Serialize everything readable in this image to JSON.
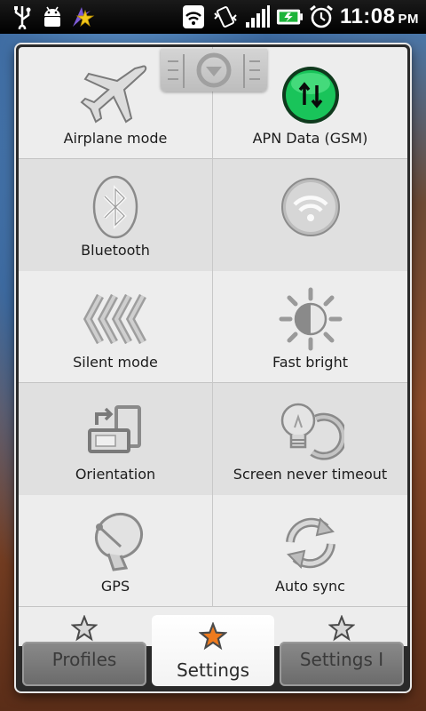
{
  "status_bar": {
    "left_icons": [
      "usb-icon",
      "android-debug-icon",
      "app-notification-icon"
    ],
    "right_icons": [
      "wifi-icon",
      "vibrate-icon",
      "signal-icon",
      "battery-icon",
      "alarm-icon"
    ],
    "time": "11:08",
    "ampm": "PM"
  },
  "grid": {
    "items": [
      {
        "label": "Airplane mode",
        "icon": "airplane-icon"
      },
      {
        "label": "APN Data (GSM)",
        "icon": "apn-data-icon",
        "state": "on"
      },
      {
        "label": "Bluetooth",
        "icon": "bluetooth-icon"
      },
      {
        "label": "",
        "icon": "wifi-toggle-icon"
      },
      {
        "label": "Silent mode",
        "icon": "silent-mode-icon"
      },
      {
        "label": "Fast bright",
        "icon": "brightness-icon"
      },
      {
        "label": "Orientation",
        "icon": "orientation-icon"
      },
      {
        "label": "Screen never timeout",
        "icon": "screen-timeout-icon"
      },
      {
        "label": "GPS",
        "icon": "gps-icon"
      },
      {
        "label": "Auto sync",
        "icon": "auto-sync-icon"
      }
    ]
  },
  "tabs": [
    {
      "label": "Profiles",
      "active": false
    },
    {
      "label": "Settings",
      "active": true
    },
    {
      "label": "Settings I",
      "active": false
    }
  ],
  "colors": {
    "apn_green": "#19c45a",
    "active_star": "#ef7b1e",
    "inactive_star": "#d8d8d8"
  }
}
